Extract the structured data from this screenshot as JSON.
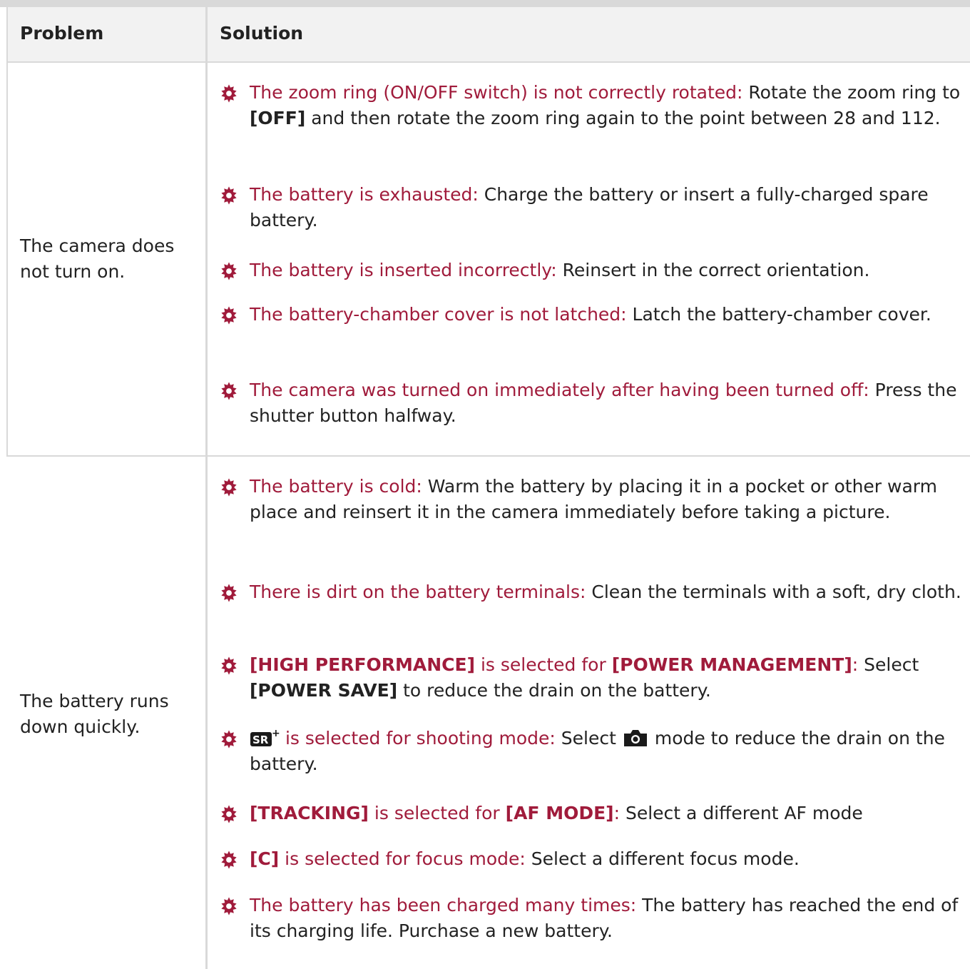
{
  "header": {
    "problem": "Problem",
    "solution": "Solution"
  },
  "rows": [
    {
      "problem": "The camera does not turn on.",
      "items": [
        {
          "cause": "The zoom ring (ON/OFF switch) is not correctly rotated:",
          "sol1": " Rotate the zoom ring to ",
          "bold1": "[OFF]",
          "sol2": " and then rotate the zoom ring again to the point between 28 and 112."
        },
        {
          "cause": "The battery is exhausted:",
          "sol1": " Charge the battery or insert a fully-charged spare battery."
        },
        {
          "cause": "The battery is inserted incorrectly:",
          "sol1": " Reinsert in the correct orientation."
        },
        {
          "cause": "The battery-chamber cover is not latched:",
          "sol1": " Latch the battery-chamber cover."
        },
        {
          "cause": "The camera was turned on immediately after having been turned off:",
          "sol1": " Press the shutter button halfway."
        }
      ]
    },
    {
      "problem": "The battery runs down quickly.",
      "items": [
        {
          "cause": "The battery is cold:",
          "sol1": " Warm the battery by placing it in a pocket or other warm place and reinsert it in the camera immediately before taking a picture."
        },
        {
          "cause": "There is dirt on the battery terminals:",
          "sol1": " Clean the terminals with a soft, dry cloth."
        },
        {
          "cb1": "[HIGH PERFORMANCE]",
          "cmid": " is selected for ",
          "cb2": "[POWER MANAGEMENT]",
          "cend": ":",
          "sol1": " Select ",
          "bold1": "[POWER SAVE]",
          "sol2": " to reduce the drain on the battery."
        },
        {
          "cause": " is selected for shooting mode:",
          "sol1": " Select ",
          "sol2": " mode to reduce the drain on the battery."
        },
        {
          "cb1": "[TRACKING]",
          "cmid": " is selected for ",
          "cb2": "[AF MODE]",
          "cend": ":",
          "sol1": " Select a different AF mode"
        },
        {
          "cb1": "[C]",
          "cmid": " is selected for focus mode:",
          "sol1": " Select a different focus mode."
        },
        {
          "cause": "The battery has been charged many times:",
          "sol1": " The battery has reached the end of its charging life. Purchase a new battery."
        }
      ]
    }
  ],
  "icons": {
    "bullet": "gear-icon",
    "mode_a": "sr-plus-icon",
    "mode_b": "camera-icon"
  },
  "colors": {
    "accent": "#a01b3b",
    "border": "#d9d9d9",
    "header_bg": "#f2f2f2"
  }
}
